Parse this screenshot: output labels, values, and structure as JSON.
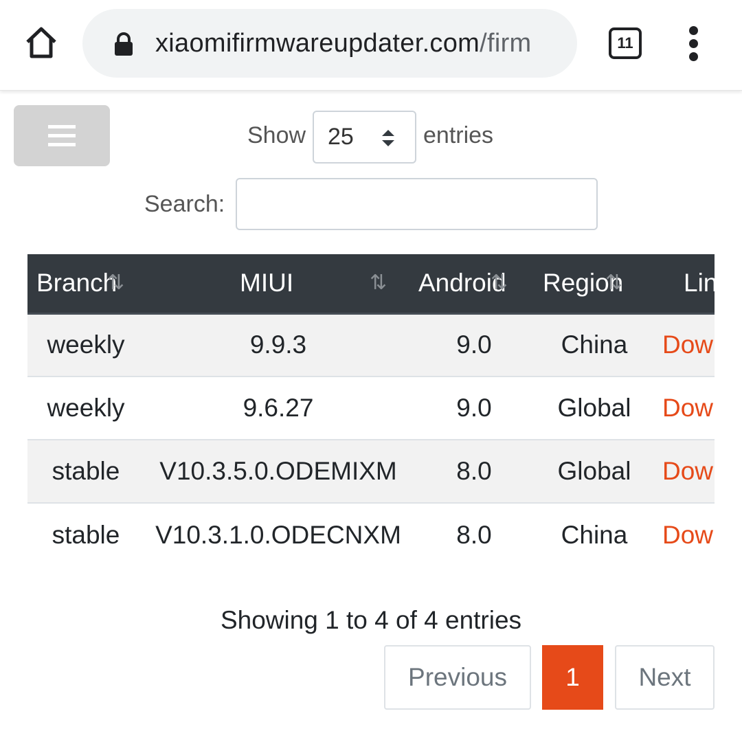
{
  "browser": {
    "url_domain": "xiaomifirmwareupdater.com",
    "url_path": "/firm",
    "tab_count": "11"
  },
  "controls": {
    "show_label": "Show",
    "page_length": "25",
    "entries_label": "entries",
    "search_label": "Search:",
    "search_value": ""
  },
  "table": {
    "headers": [
      "Branch",
      "MIUI",
      "Android",
      "Region",
      "Link"
    ],
    "rows": [
      {
        "branch": "weekly",
        "miui": "9.9.3",
        "android": "9.0",
        "region": "China",
        "link": "Download"
      },
      {
        "branch": "weekly",
        "miui": "9.6.27",
        "android": "9.0",
        "region": "Global",
        "link": "Download"
      },
      {
        "branch": "stable",
        "miui": "V10.3.5.0.ODEMIXM",
        "android": "8.0",
        "region": "Global",
        "link": "Download"
      },
      {
        "branch": "stable",
        "miui": "V10.3.1.0.ODECNXM",
        "android": "8.0",
        "region": "China",
        "link": "Download"
      }
    ]
  },
  "footer": {
    "info": "Showing 1 to 4 of 4 entries",
    "previous": "Previous",
    "current_page": "1",
    "next": "Next"
  },
  "colors": {
    "header_bg": "#343a40",
    "accent": "#e64a19",
    "stripe": "#f2f2f2"
  },
  "icons": [
    "home-icon",
    "lock-icon",
    "tab-switcher-icon",
    "more-vert-icon",
    "hamburger-icon",
    "select-caret-icon",
    "sort-icon"
  ]
}
